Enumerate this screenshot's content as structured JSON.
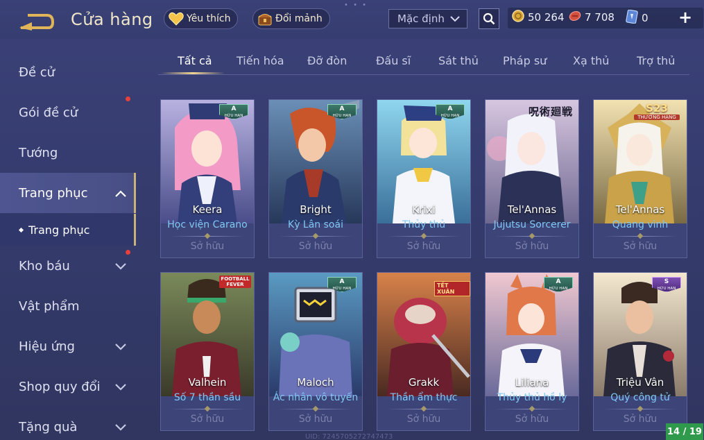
{
  "header": {
    "title": "Cửa hàng",
    "favorite_label": "Yêu thích",
    "exchange_label": "Đổi mảnh",
    "sort_value": "Mặc định"
  },
  "currencies": [
    {
      "icon": "gold-coin-icon",
      "value": "50 264"
    },
    {
      "icon": "voucher-icon",
      "value": "7 708"
    },
    {
      "icon": "crystal-card-icon",
      "value": "0"
    }
  ],
  "sidebar": {
    "items": [
      {
        "label": "Đề cử"
      },
      {
        "label": "Gói đề cử"
      },
      {
        "label": "Tướng"
      },
      {
        "label": "Trang phục"
      },
      {
        "label": "Kho báu"
      },
      {
        "label": "Vật phẩm"
      },
      {
        "label": "Hiệu ứng"
      },
      {
        "label": "Shop quy đổi"
      },
      {
        "label": "Tặng quà"
      }
    ],
    "sub_item": "Trang phục"
  },
  "tabs": [
    "Tất cả",
    "Tiến hóa",
    "Đỡ đòn",
    "Đấu sĩ",
    "Sát thủ",
    "Pháp sư",
    "Xạ thủ",
    "Trợ thủ"
  ],
  "cards": [
    {
      "hero": "Keera",
      "skin": "Học viện Carano",
      "status": "Sở hữu",
      "badge": "A",
      "badge_text": "HỮU HẠN"
    },
    {
      "hero": "Bright",
      "skin": "Kỳ Lân soái",
      "status": "Sở hữu",
      "badge": "A",
      "badge_text": "HỮU HẠN"
    },
    {
      "hero": "Krixi",
      "skin": "Thủy thủ",
      "status": "Sở hữu",
      "badge": "A",
      "badge_text": "HỮU HẠN"
    },
    {
      "hero": "Tel'Annas",
      "skin": "Jujutsu Sorcerer",
      "status": "Sở hữu",
      "badge_text": "呪術廻戦"
    },
    {
      "hero": "Tel'Annas",
      "skin": "Quang vinh",
      "status": "Sở hữu",
      "badge": "S23",
      "badge_text": "THƯỞNG HẠNG"
    },
    {
      "hero": "Valhein",
      "skin": "Số 7 thần sầu",
      "status": "Sở hữu",
      "badge_text": "FOOTBALL FEVER"
    },
    {
      "hero": "Maloch",
      "skin": "Ác nhân vô tuyến",
      "status": "Sở hữu",
      "badge": "A",
      "badge_text": "HỮU HẠN"
    },
    {
      "hero": "Grakk",
      "skin": "Thần ẩm thực",
      "status": "Sở hữu",
      "badge_text": "TẾT XUÂN"
    },
    {
      "hero": "Liliana",
      "skin": "Thủy thủ hồ ly",
      "status": "Sở hữu",
      "badge": "A",
      "badge_text": "HỮU HẠN"
    },
    {
      "hero": "Triệu Vân",
      "skin": "Quý công tử",
      "status": "Sở hữu",
      "badge": "S",
      "badge_text": "HỮU HẠN"
    }
  ],
  "page_indicator": "14 / 19",
  "uid_text": "UID: 7245705272747473",
  "colors": {
    "background": "#353b6d",
    "accent_gold": "#f1d591",
    "skin_name": "#7fc8f5",
    "notification_dot": "#e8403c",
    "page_indicator": "#2f9a4c"
  }
}
